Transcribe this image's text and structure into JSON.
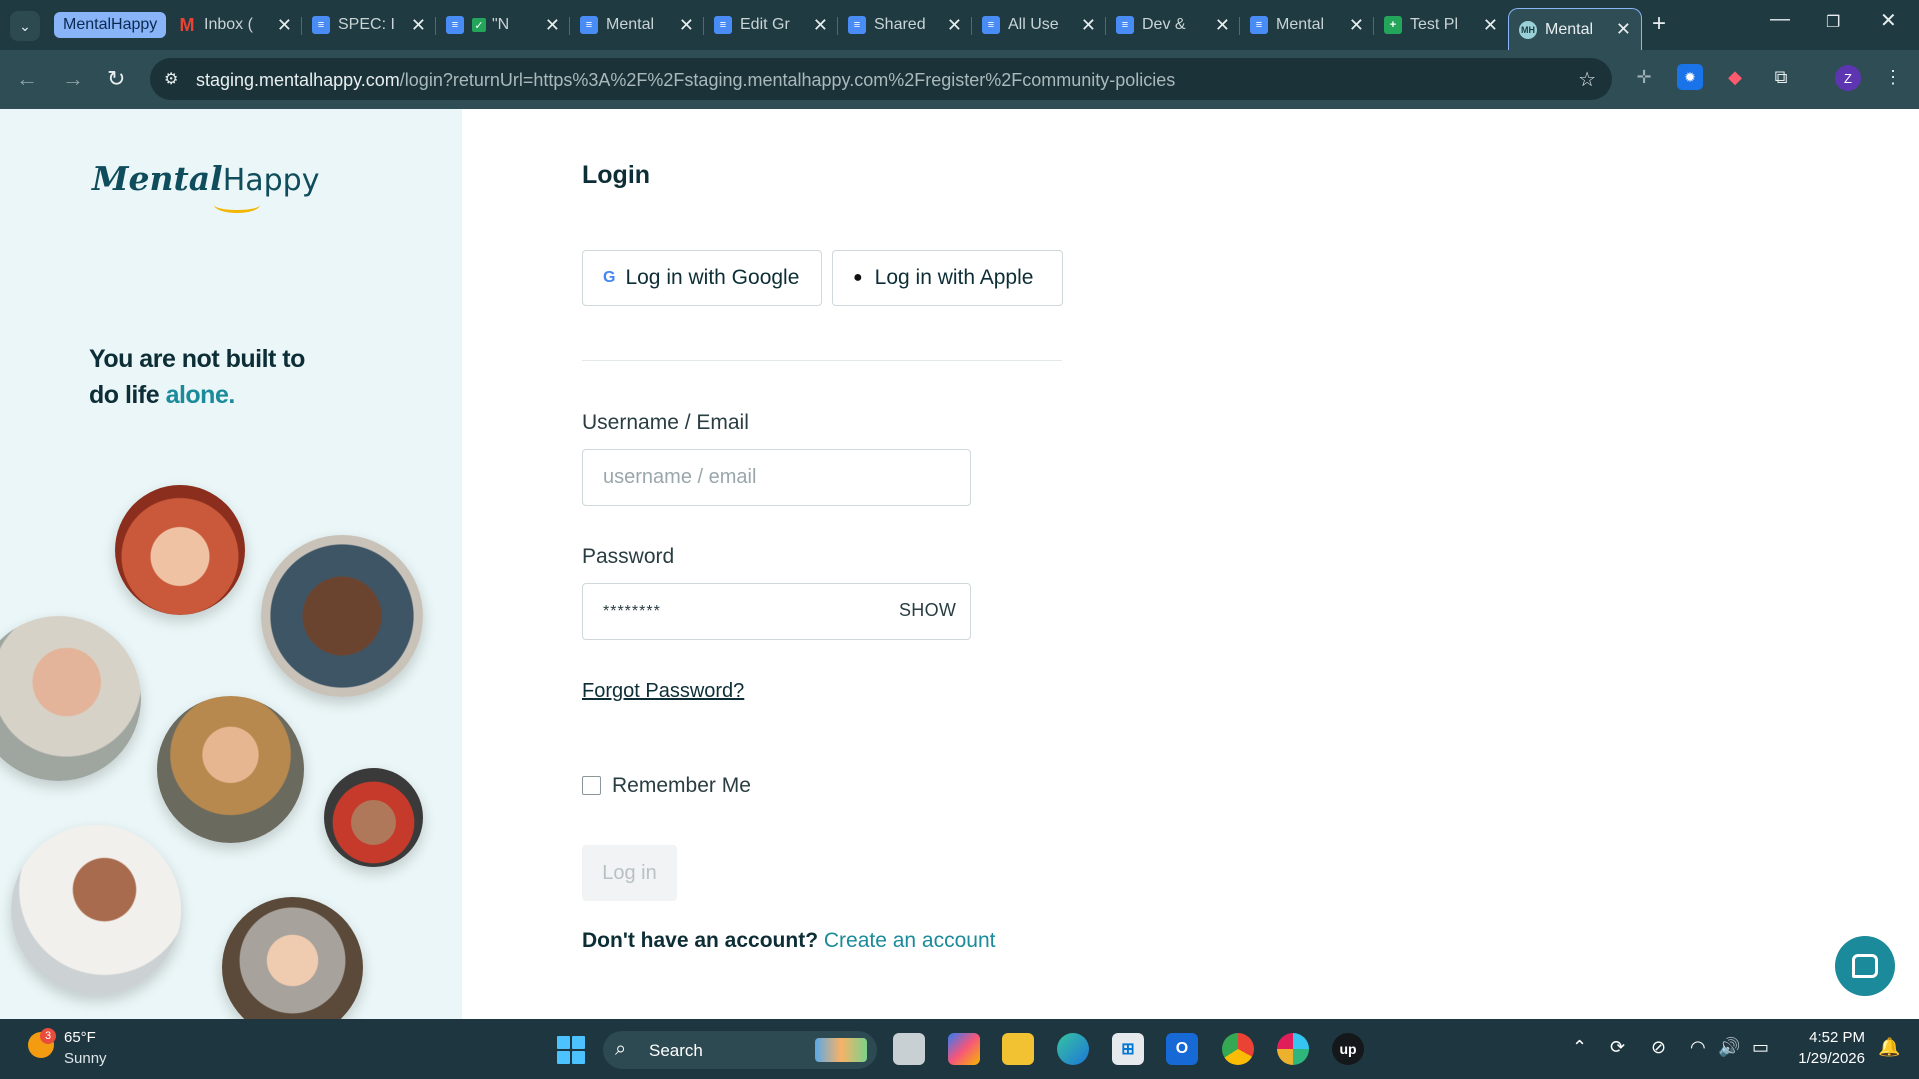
{
  "browser": {
    "tab_group_label": "MentalHappy",
    "tabs": [
      {
        "title": "Inbox (",
        "icon": "gmail-icon"
      },
      {
        "title": "SPEC: I",
        "icon": "docs-icon"
      },
      {
        "title": "\"N",
        "icon": "docs-icon"
      },
      {
        "title": "Mental",
        "icon": "docs-icon"
      },
      {
        "title": "Edit Gr",
        "icon": "docs-icon"
      },
      {
        "title": "Shared",
        "icon": "docs-icon"
      },
      {
        "title": "All Use",
        "icon": "docs-icon"
      },
      {
        "title": "Dev &",
        "icon": "docs-icon"
      },
      {
        "title": "Mental",
        "icon": "docs-icon"
      },
      {
        "title": "Test Pl",
        "icon": "sheets-icon"
      },
      {
        "title": "Mental",
        "icon": "mentalhappy-favicon-icon",
        "active": true
      }
    ],
    "url_host": "staging.mentalhappy.com",
    "url_path": "/login?returnUrl=https%3A%2F%2Fstaging.mentalhappy.com%2Fregister%2Fcommunity-policies",
    "profile_initial": "Z"
  },
  "sidebar": {
    "logo_part1": "Mental",
    "logo_part2": "Happy",
    "tagline_line1": "You are not built to",
    "tagline_line2_prefix": "do life ",
    "tagline_accent": "alone."
  },
  "login": {
    "title": "Login",
    "google_button": "Log in with Google",
    "apple_button": "Log in with Apple",
    "username_label": "Username / Email",
    "username_placeholder": "username / email",
    "password_label": "Password",
    "password_value": "********",
    "show_label": "SHOW",
    "forgot_link": "Forgot Password?",
    "remember_label": "Remember Me",
    "login_button": "Log in",
    "signup_prompt": "Don't have an account?",
    "signup_link": "Create an account"
  },
  "taskbar": {
    "weather_badge": "3",
    "weather_temp": "65°F",
    "weather_desc": "Sunny",
    "search_label": "Search",
    "time": "4:52 PM",
    "date": "1/29/2026"
  },
  "colors": {
    "brand_teal": "#1b8a9a",
    "brand_dark": "#0f4c5c",
    "sidebar_bg": "#eaf6f7",
    "chrome_bg": "#1f3a40"
  }
}
